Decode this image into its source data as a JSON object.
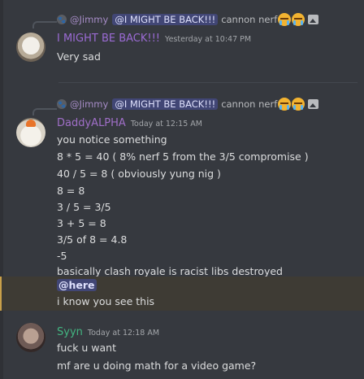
{
  "messages": [
    {
      "reply": {
        "user": "@Jimmy",
        "mention": "@I MIGHT BE BACK!!!",
        "text": "cannon nerf"
      },
      "author": {
        "name": "I MIGHT BE BACK!!!",
        "color": "#9b6bd4"
      },
      "timestamp": "Yesterday at 10:47 PM",
      "lines": [
        "Very sad"
      ]
    },
    {
      "reply": {
        "user": "@Jimmy",
        "mention": "@I MIGHT BE BACK!!!",
        "text": "cannon nerf"
      },
      "author": {
        "name": "DaddyALPHA",
        "color": "#a06fc8"
      },
      "timestamp": "Today at 12:15 AM",
      "lines": [
        "you notice something",
        "8 * 5 = 40 ( 8% nerf 5 from the 3/5 compromise )",
        "40 / 5 = 8 ( obviously yung nig )",
        "8 = 8",
        "3 / 5 = 3/5",
        "3 + 5 = 8",
        "3/5 of 8 = 4.8",
        "-5",
        "basically clash royale is racist libs destroyed"
      ],
      "highlighted": {
        "mention": "@here",
        "text": "i know you see this",
        "accent": "#c9a04a"
      }
    },
    {
      "author": {
        "name": "Syyn",
        "color": "#43b581"
      },
      "timestamp": "Today at 12:18 AM",
      "lines": [
        "fuck u want",
        "mf are u doing math for a video game?"
      ]
    }
  ],
  "icons": {
    "reply_emoji": "crying-face-emoji",
    "attachment": "image-icon"
  }
}
